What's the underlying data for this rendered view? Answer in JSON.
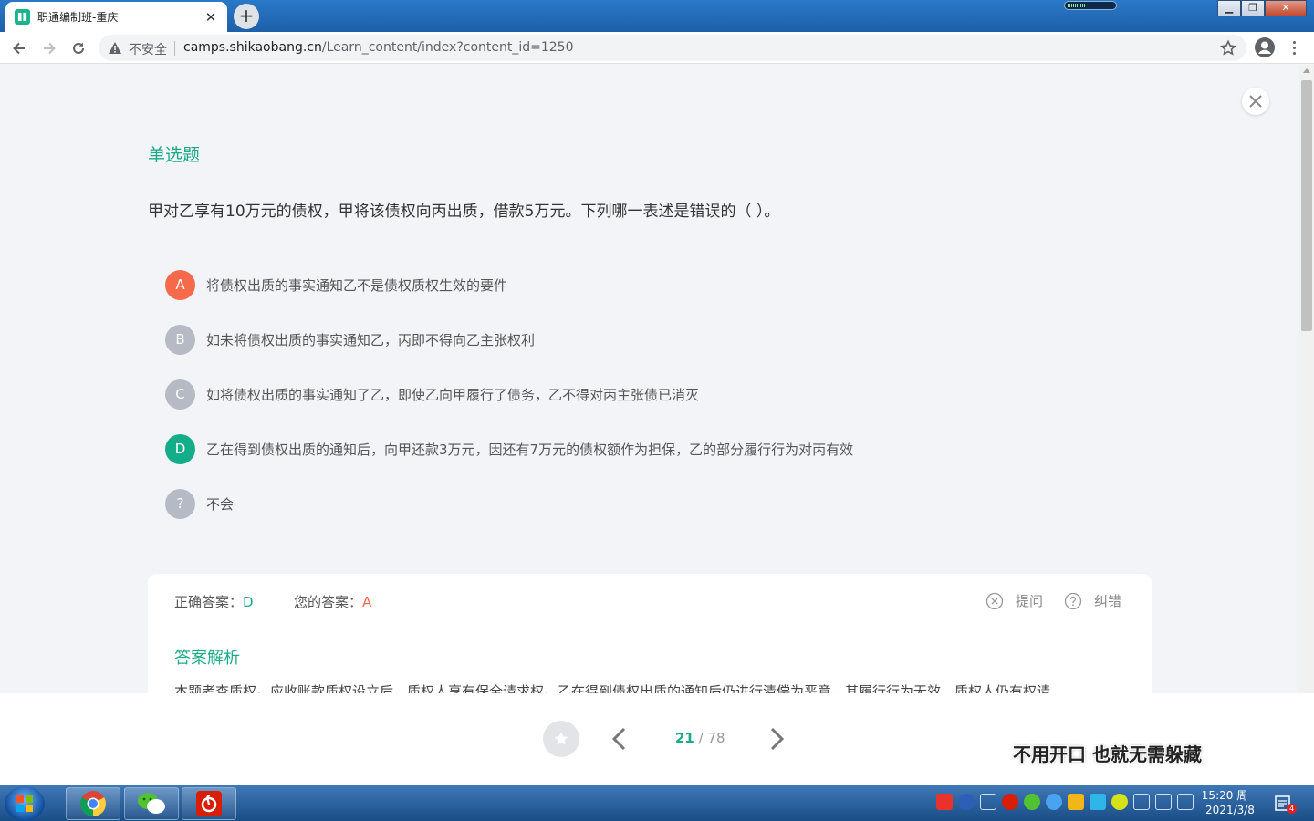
{
  "browser": {
    "tab": {
      "title": "职通编制班-重庆"
    },
    "address": {
      "security_label": "不安全",
      "host": "camps.shikaobang.cn",
      "path": "/Learn_content/index?content_id=1250"
    }
  },
  "question": {
    "type_label": "单选题",
    "stem": "甲对乙享有10万元的债权，甲将该债权向丙出质，借款5万元。下列哪一表述是错误的（  ）。",
    "options": [
      {
        "key": "A",
        "text": "将债权出质的事实通知乙不是债权质权生效的要件",
        "state": "wrong-selected",
        "color": "#f46a4a"
      },
      {
        "key": "B",
        "text": "如未将债权出质的事实通知乙，丙即不得向乙主张权利",
        "state": "normal",
        "color": "#b5bac4"
      },
      {
        "key": "C",
        "text": "如将债权出质的事实通知了乙，即使乙向甲履行了债务，乙不得对丙主张债已消灭",
        "state": "normal",
        "color": "#b5bac4"
      },
      {
        "key": "D",
        "text": "乙在得到债权出质的通知后，向甲还款3万元，因还有7万元的债权额作为担保，乙的部分履行行为对丙有效",
        "state": "correct",
        "color": "#13ad8a"
      },
      {
        "key": "?",
        "text": "不会",
        "state": "normal",
        "color": "#b5bac4"
      }
    ]
  },
  "answer": {
    "correct_label": "正确答案：",
    "correct_value": "D",
    "mine_label": "您的答案：",
    "mine_value": "A",
    "ask_label": "提问",
    "report_label": "纠错",
    "analysis_title": "答案解析",
    "analysis_text": "本题考查质权。应收账款质权设立后，质权人享有保全请求权。乙在得到债权出质的通知后仍进行清偿为恶意，其履行行为无效，质权人仍有权请"
  },
  "pager": {
    "current": "21",
    "total": "78",
    "separator": " / "
  },
  "caption": "不用开口 也就无需躲藏",
  "taskbar": {
    "clock_time": "15:20 周一",
    "clock_date": "2021/3/8",
    "notification_count": "4"
  },
  "colors": {
    "accent": "#1aaa8a",
    "wrong": "#f46a4a",
    "correct": "#13ad8a"
  }
}
